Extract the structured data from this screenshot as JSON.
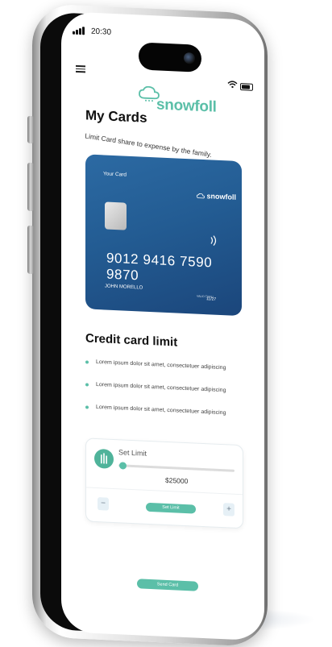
{
  "status_bar": {
    "time": "20:30"
  },
  "brand": {
    "name": "snowfoll",
    "accent_color": "#5bbfa8"
  },
  "page": {
    "title": "My Cards",
    "subtitle": "Limit Card share to expense by the family."
  },
  "card": {
    "label": "Your Card",
    "brand": "snowfoll",
    "number": "9012 9416 7590 9870",
    "holder": "JOHN MORELLO",
    "expiry_label": "VALID THRU",
    "expiry": "11/27"
  },
  "limit_section": {
    "title": "Credit card limit",
    "bullets": [
      "Lorem ipsum dolor sit amet, consectetuer adipiscing",
      "Lorem ipsum dolor sit amet, consectetuer adipiscing",
      "Lorem ipsum dolor sit amet, consectetuer adipiscing"
    ]
  },
  "set_limit": {
    "label": "Set Limit",
    "amount": "$25000",
    "slider_fraction": 0.02,
    "minus_label": "−",
    "plus_label": "+",
    "button_label": "Set Limit"
  },
  "footer": {
    "send_button_label": "Send Card"
  },
  "icons": {
    "menu": "hamburger-menu-icon",
    "wifi": "wifi-icon",
    "battery": "battery-icon",
    "signal": "signal-icon",
    "contactless": "contactless-icon",
    "cloud": "cloud-logo-icon"
  }
}
